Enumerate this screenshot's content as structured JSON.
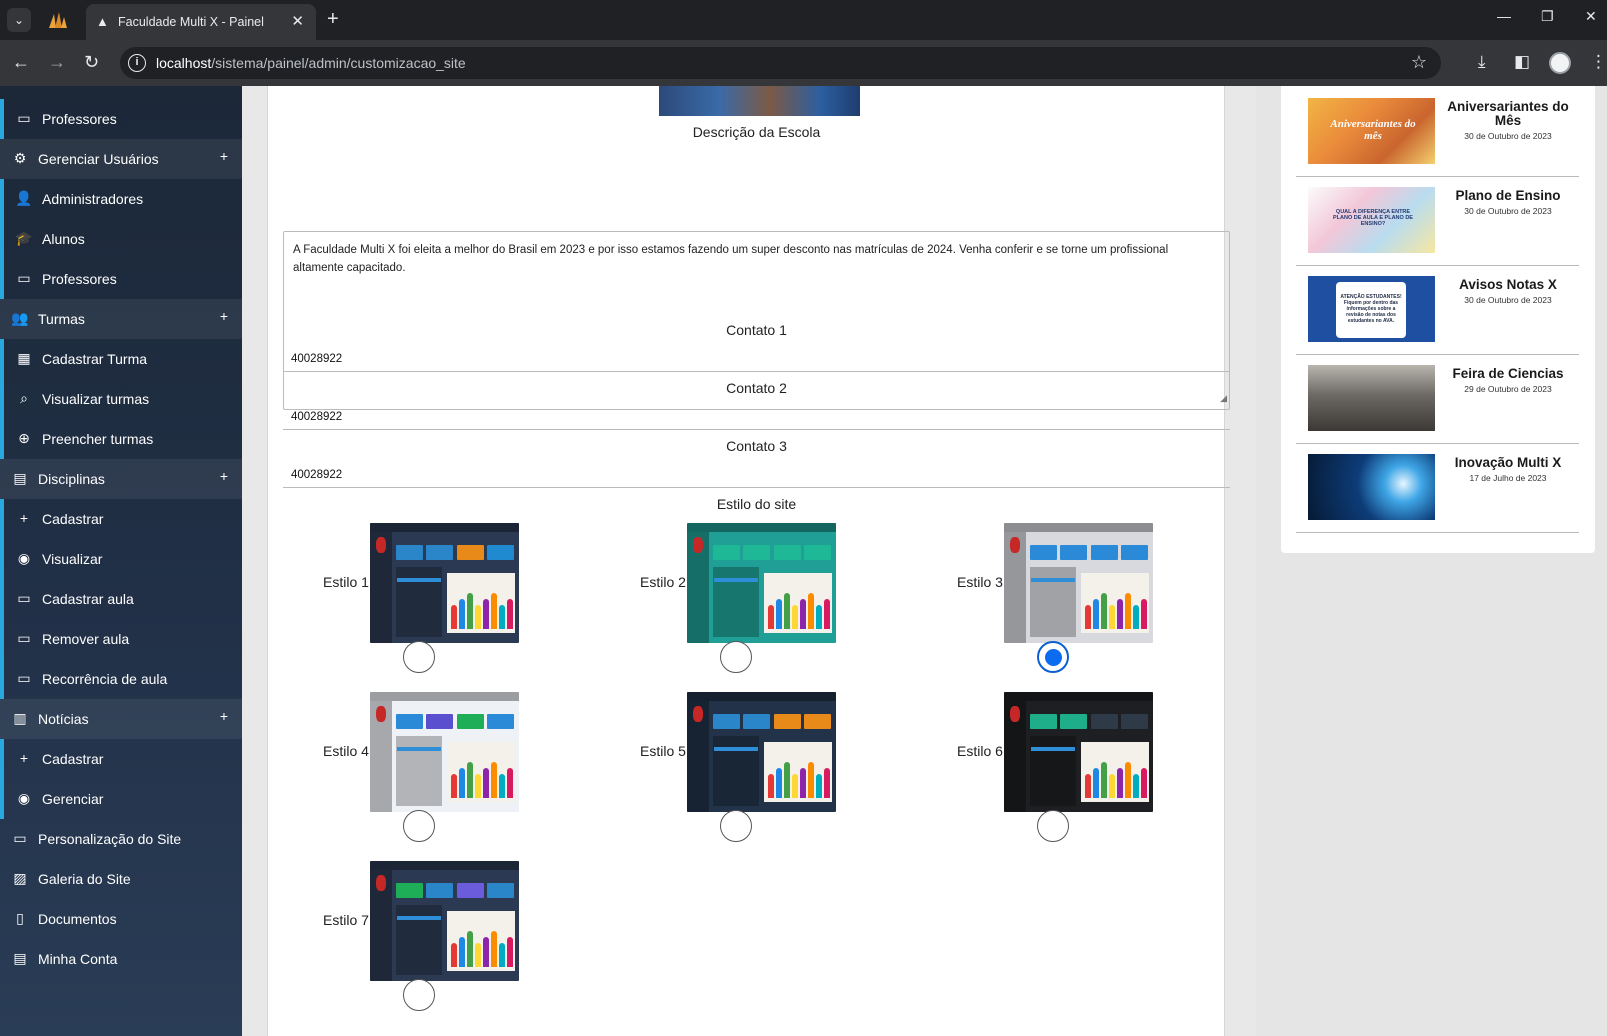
{
  "browser": {
    "tab_title": "Faculdade Multi X - Painel",
    "url_host": "localhost",
    "url_path": "/sistema/painel/admin/customizacao_site"
  },
  "sidebar": {
    "items": [
      {
        "label": "Professores",
        "icon": "chalkboard-icon",
        "kind": "sub"
      },
      {
        "label": "Gerenciar Usuários",
        "icon": "users-cog-icon",
        "kind": "group"
      },
      {
        "label": "Administradores",
        "icon": "user-tie-icon",
        "kind": "sub"
      },
      {
        "label": "Alunos",
        "icon": "user-graduate-icon",
        "kind": "sub"
      },
      {
        "label": "Professores",
        "icon": "chalkboard-icon",
        "kind": "sub"
      },
      {
        "label": "Turmas",
        "icon": "users-icon",
        "kind": "group"
      },
      {
        "label": "Cadastrar Turma",
        "icon": "table-icon",
        "kind": "sub"
      },
      {
        "label": "Visualizar turmas",
        "icon": "search-icon",
        "kind": "sub"
      },
      {
        "label": "Preencher turmas",
        "icon": "user-plus-icon",
        "kind": "sub"
      },
      {
        "label": "Disciplinas",
        "icon": "book-icon",
        "kind": "group"
      },
      {
        "label": "Cadastrar",
        "icon": "plus-icon",
        "kind": "sub"
      },
      {
        "label": "Visualizar",
        "icon": "eye-icon",
        "kind": "sub"
      },
      {
        "label": "Cadastrar aula",
        "icon": "chalkboard-icon",
        "kind": "sub"
      },
      {
        "label": "Remover aula",
        "icon": "chalkboard-icon",
        "kind": "sub"
      },
      {
        "label": "Recorrência de aula",
        "icon": "chalkboard-icon",
        "kind": "sub"
      },
      {
        "label": "Notícias",
        "icon": "newspaper-icon",
        "kind": "group"
      },
      {
        "label": "Cadastrar",
        "icon": "plus-icon",
        "kind": "sub"
      },
      {
        "label": "Gerenciar",
        "icon": "eye-icon",
        "kind": "sub"
      },
      {
        "label": "Personalização do Site",
        "icon": "laptop-icon",
        "kind": "top"
      },
      {
        "label": "Galeria do Site",
        "icon": "image-icon",
        "kind": "top"
      },
      {
        "label": "Documentos",
        "icon": "file-icon",
        "kind": "top"
      },
      {
        "label": "Minha Conta",
        "icon": "id-card-icon",
        "kind": "top"
      }
    ]
  },
  "form": {
    "description_label": "Descrição da Escola",
    "description_text": "A Faculdade Multi X foi eleita a melhor do Brasil em 2023 e por isso estamos fazendo um super desconto nas matrículas de 2024. Venha conferir e se torne um profissional altamente capacitado.",
    "contact1_label": "Contato 1",
    "contact1_value": "40028922",
    "contact2_label": "Contato 2",
    "contact2_value": "40028922",
    "contact3_label": "Contato 3",
    "contact3_value": "40028922",
    "style_label": "Estilo do site",
    "styles": [
      {
        "label": "Estilo 1",
        "selected": false,
        "bg": "#2b3a52",
        "cards": [
          "#2a86c9",
          "#2a86c9",
          "#e88a1a",
          "#1f8ad0"
        ]
      },
      {
        "label": "Estilo 2",
        "selected": false,
        "bg": "#1f9f95",
        "cards": [
          "#1eb897",
          "#1eb897",
          "#1eb897",
          "#1eb897"
        ]
      },
      {
        "label": "Estilo 3",
        "selected": true,
        "bg": "#d7d9de",
        "cards": [
          "#2b8ad8",
          "#2b8ad8",
          "#2b8ad8",
          "#2b8ad8"
        ]
      },
      {
        "label": "Estilo 4",
        "selected": false,
        "bg": "#eef1f6",
        "cards": [
          "#2b8ad8",
          "#5a4fcf",
          "#1fae58",
          "#2b8ad8"
        ]
      },
      {
        "label": "Estilo 5",
        "selected": false,
        "bg": "#223349",
        "cards": [
          "#2a86c9",
          "#2a86c9",
          "#e88a1a",
          "#e88a1a"
        ]
      },
      {
        "label": "Estilo 6",
        "selected": false,
        "bg": "#1e1f22",
        "cards": [
          "#1fae8a",
          "#1fae8a",
          "#2f3a48",
          "#2f3a48"
        ]
      },
      {
        "label": "Estilo 7",
        "selected": false,
        "bg": "#2b3a52",
        "cards": [
          "#1fae58",
          "#2a86c9",
          "#6b5cdc",
          "#2a86c9"
        ]
      }
    ]
  },
  "news": [
    {
      "title": "Aniversariantes do Mês",
      "date": "30 de Outubro de 2023"
    },
    {
      "title": "Plano de Ensino",
      "date": "30 de Outubro de 2023"
    },
    {
      "title": "Avisos Notas X",
      "date": "30 de Outubro de 2023"
    },
    {
      "title": "Feira de Ciencias",
      "date": "29 de Outubro de 2023"
    },
    {
      "title": "Inovação Multi X",
      "date": "17 de Julho de 2023"
    }
  ],
  "news_image_texts": {
    "0": "Aniversariantes do mês",
    "1": "QUAL A DIFERENÇA ENTRE PLANO DE AULA E PLANO DE ENSINO?",
    "2": "ATENÇÃO ESTUDANTES! Fiquem por dentro das informações sobre a revisão de notas dos estudantes no AVA."
  }
}
